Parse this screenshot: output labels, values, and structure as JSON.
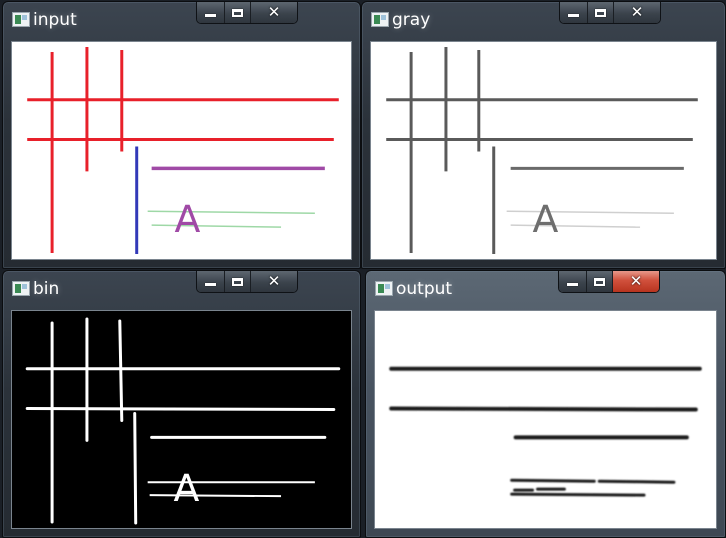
{
  "windows": {
    "input": {
      "title": "input",
      "close_glyph": "X",
      "max_glyph": "",
      "min_glyph": ""
    },
    "gray": {
      "title": "gray",
      "close_glyph": "X",
      "max_glyph": "",
      "min_glyph": ""
    },
    "bin": {
      "title": "bin",
      "close_glyph": "X",
      "max_glyph": "",
      "min_glyph": ""
    },
    "output": {
      "title": "output",
      "close_glyph": "X",
      "max_glyph": "",
      "min_glyph": ""
    }
  },
  "image_text": {
    "letter": "A"
  },
  "colors": {
    "red_line": "#e8202a",
    "blue_line": "#3239b8",
    "purple_line": "#a04aa6",
    "green_line": "#9ed8a6",
    "gray_line": "#5a5a5a",
    "light_gray_line": "#cfcfcf",
    "close_active": "#c8402c"
  },
  "icons": [
    "app-window-icon",
    "minimize-icon",
    "maximize-icon",
    "close-icon"
  ]
}
